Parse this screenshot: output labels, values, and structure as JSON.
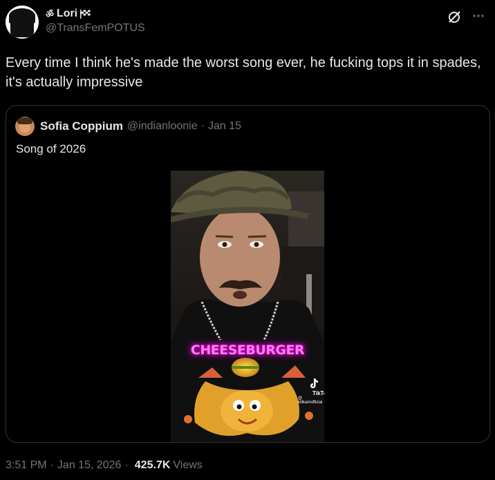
{
  "tweet": {
    "display_name_prefix": "ॐ",
    "display_name": "Lori",
    "handle": "@TransFemPOTUS",
    "text": "Every time I think he's made the worst song ever, he fucking tops it in spades, it's actually impressive",
    "time": "3:51 PM",
    "date": "Jan 15, 2026",
    "views_count": "425.7K",
    "views_label": "Views"
  },
  "quote": {
    "display_name": "Sofia Coppium",
    "handle": "@indianloonie",
    "date": "Jan 15",
    "text": "Song of 2026",
    "video_caption": "CHEESEBURGER",
    "watermark": "TikTok",
    "watermark_user": "@ killkamofficial"
  },
  "icons": {
    "grok": "grok-icon",
    "more": "more-icon",
    "flag": "checkered-flag-icon",
    "tiktok": "tiktok-icon"
  },
  "colors": {
    "background": "#000000",
    "text_primary": "#e7e9ea",
    "text_secondary": "#71767b",
    "border": "#2f3336",
    "neon_caption": "#ff7cf5"
  }
}
